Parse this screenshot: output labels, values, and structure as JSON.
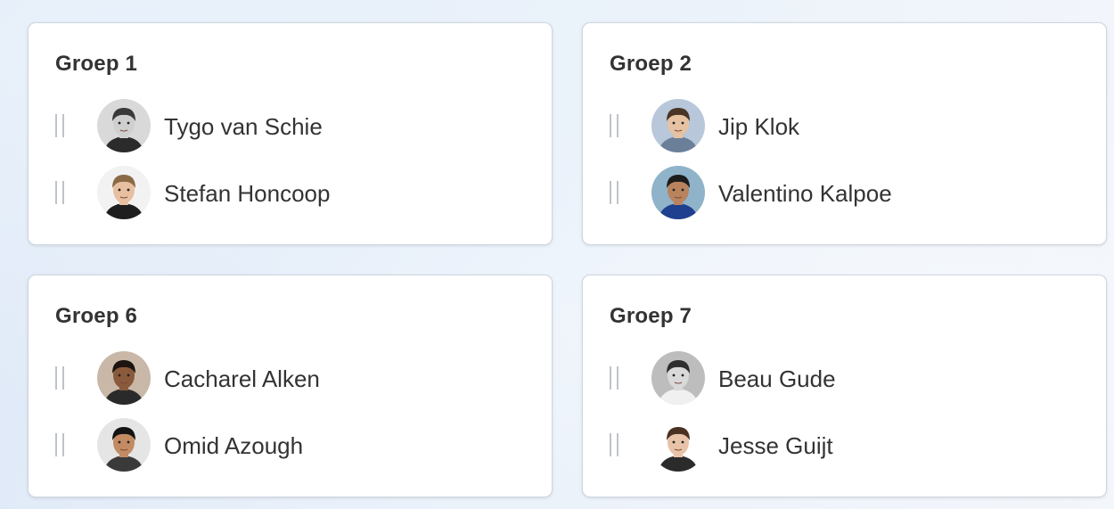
{
  "groups": [
    {
      "title": "Groep 1",
      "members": [
        {
          "name": "Tygo van Schie",
          "avatar": {
            "bg": "#d9d9d9",
            "skin": "#cfcfcf",
            "hair": "#3a3a3a",
            "shirt": "#2b2b2b"
          }
        },
        {
          "name": "Stefan Honcoop",
          "avatar": {
            "bg": "#f2f2f2",
            "skin": "#e8bfa0",
            "hair": "#8a6a45",
            "shirt": "#1e1e1e"
          }
        }
      ]
    },
    {
      "title": "Groep 2",
      "members": [
        {
          "name": "Jip Klok",
          "avatar": {
            "bg": "#b8c7d9",
            "skin": "#e6c2a3",
            "hair": "#4a3425",
            "shirt": "#6b7f99"
          }
        },
        {
          "name": "Valentino Kalpoe",
          "avatar": {
            "bg": "#8fb3c9",
            "skin": "#b8835e",
            "hair": "#1c1c1c",
            "shirt": "#1f3f8f"
          }
        }
      ]
    },
    {
      "title": "Groep 6",
      "members": [
        {
          "name": "Cacharel Alken",
          "avatar": {
            "bg": "#c9b8a8",
            "skin": "#8a5a3c",
            "hair": "#1c1410",
            "shirt": "#2a2a2a"
          }
        },
        {
          "name": "Omid Azough",
          "avatar": {
            "bg": "#e5e5e5",
            "skin": "#c38b63",
            "hair": "#141414",
            "shirt": "#3a3a3a"
          }
        }
      ]
    },
    {
      "title": "Groep 7",
      "members": [
        {
          "name": "Beau Gude",
          "avatar": {
            "bg": "#bdbdbd",
            "skin": "#d9d9d9",
            "hair": "#2e2e2e",
            "shirt": "#f0f0f0"
          }
        },
        {
          "name": "Jesse Guijt",
          "avatar": {
            "bg": "#ffffff",
            "skin": "#e8c3a8",
            "hair": "#4a3020",
            "shirt": "#2b2b2b"
          }
        }
      ]
    }
  ]
}
